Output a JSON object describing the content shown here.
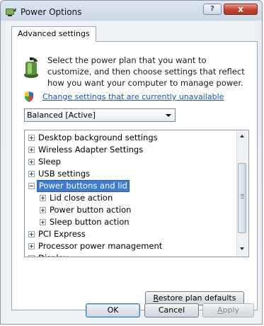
{
  "window": {
    "title": "Power Options",
    "help_label": "?",
    "close_label": "x"
  },
  "tab": {
    "label": "Advanced settings"
  },
  "intro": {
    "text": "Select the power plan that you want to customize, and then choose settings that reflect how you want your computer to manage power."
  },
  "change_link": "Change settings that are currently unavailable",
  "plan_select": {
    "value": "Balanced [Active]"
  },
  "tree": {
    "items": [
      {
        "label": "Desktop background settings",
        "expander": "plus",
        "level": 0,
        "selected": false
      },
      {
        "label": "Wireless Adapter Settings",
        "expander": "plus",
        "level": 0,
        "selected": false
      },
      {
        "label": "Sleep",
        "expander": "plus",
        "level": 0,
        "selected": false
      },
      {
        "label": "USB settings",
        "expander": "plus",
        "level": 0,
        "selected": false
      },
      {
        "label": "Power buttons and lid",
        "expander": "minus",
        "level": 0,
        "selected": true
      },
      {
        "label": "Lid close action",
        "expander": "plus",
        "level": 1,
        "selected": false
      },
      {
        "label": "Power button action",
        "expander": "plus",
        "level": 1,
        "selected": false
      },
      {
        "label": "Sleep button action",
        "expander": "plus",
        "level": 1,
        "selected": false
      },
      {
        "label": "PCI Express",
        "expander": "plus",
        "level": 0,
        "selected": false
      },
      {
        "label": "Processor power management",
        "expander": "plus",
        "level": 0,
        "selected": false
      },
      {
        "label": "Display",
        "expander": "plus",
        "level": 0,
        "selected": false
      }
    ]
  },
  "buttons": {
    "restore": {
      "first": "R",
      "rest": "estore plan defaults"
    },
    "ok": "OK",
    "cancel": "Cancel",
    "apply": {
      "first": "A",
      "rest": "pply"
    }
  },
  "colors": {
    "accent": "#3d7bd6",
    "link": "#1b54b8"
  }
}
